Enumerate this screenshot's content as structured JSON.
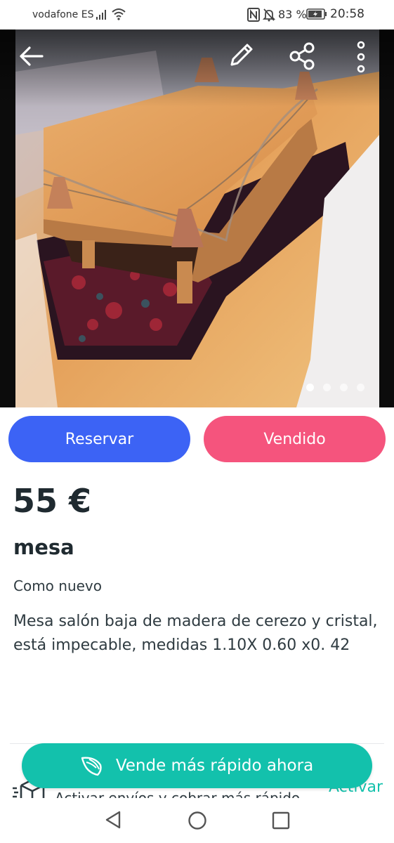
{
  "status_bar": {
    "carrier": "vodafone ES",
    "battery": "83 %",
    "time": "20:58",
    "icons": [
      "signal-icon",
      "wifi-icon",
      "nfc-icon",
      "notifications-muted-icon",
      "battery-icon"
    ]
  },
  "gallery": {
    "image_count": 4,
    "active_index": 0,
    "icons": {
      "back": "arrow-left-icon",
      "edit": "pencil-icon",
      "share": "share-icon",
      "more": "more-vertical-icon"
    }
  },
  "actions": {
    "reserve_label": "Reservar",
    "sold_label": "Vendido",
    "reserve_color": "#3c63f5",
    "sold_color": "#f5547d"
  },
  "item": {
    "price": "55 €",
    "title": "mesa",
    "condition": "Como nuevo",
    "description": "Mesa salón baja de madera de cerezo y cristal, está impecable, medidas 1.10X 0.60 x0. 42"
  },
  "shipping_row": {
    "text": "Activar envíos y cobrar más rápido",
    "link_label": "Activar",
    "icon": "box-icon"
  },
  "promo": {
    "label": "Vende más rápido ahora",
    "icon": "wing-icon",
    "color": "#13c1ac"
  },
  "nav_bar": {
    "icons": [
      "nav-back-icon",
      "nav-home-icon",
      "nav-recent-icon"
    ]
  }
}
